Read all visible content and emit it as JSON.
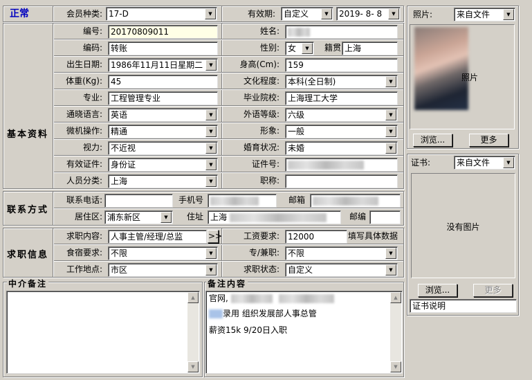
{
  "status": {
    "label": "正常",
    "color": "#0000c0"
  },
  "header": {
    "member_type_label": "会员种类:",
    "member_type_value": "17-D",
    "validity_label": "有效期:",
    "validity_mode": "自定义",
    "validity_date": "2019- 8- 8"
  },
  "sections": {
    "basic": "基本资料",
    "contact": "联系方式",
    "job": "求职信息",
    "agency_notes": "中介备注",
    "notes": "备注内容"
  },
  "basic": {
    "id_label": "编号:",
    "id_value": "20170809011",
    "code_label": "编码:",
    "code_value": "转账",
    "birth_label": "出生日期:",
    "birth_value": "1986年11月11日星期二",
    "weight_label": "体重(Kg):",
    "weight_value": "45",
    "major_label": "专业:",
    "major_value": "工程管理专业",
    "language_label": "通晓语言:",
    "language_value": "英语",
    "computer_label": "微机操作:",
    "computer_value": "精通",
    "vision_label": "视力:",
    "vision_value": "不近视",
    "id_doc_label": "有效证件:",
    "id_doc_value": "身份证",
    "category_label": "人员分类:",
    "category_value": "上海",
    "name_label": "姓名:",
    "gender_label": "性别:",
    "gender_value": "女",
    "native_label": "籍贯",
    "native_value": "上海",
    "height_label": "身高(Cm):",
    "height_value": "159",
    "education_label": "文化程度:",
    "education_value": "本科(全日制)",
    "school_label": "毕业院校:",
    "school_value": "上海理工大学",
    "foreign_level_label": "外语等级:",
    "foreign_level_value": "六级",
    "appearance_label": "形象:",
    "appearance_value": "一般",
    "marital_label": "婚育状况:",
    "marital_value": "未婚",
    "cert_no_label": "证件号:",
    "title_label": "职称:"
  },
  "contact": {
    "phone_label": "联系电话:",
    "mobile_label": "手机号",
    "email_label": "邮箱",
    "district_label": "居住区:",
    "district_value": "浦东新区",
    "address_label": "住址",
    "address_value": "上海",
    "postcode_label": "邮编"
  },
  "job": {
    "content_label": "求职内容:",
    "content_value": "人事主管/经理/总监",
    "more_btn": ">>",
    "salary_label": "工资要求:",
    "salary_value": "12000",
    "salary_hint": "填写具体数据",
    "board_label": "食宿要求:",
    "board_value": "不限",
    "fulltime_label": "专/兼职:",
    "fulltime_value": "不限",
    "location_label": "工作地点:",
    "location_value": "市区",
    "status_label": "求职状态:",
    "status_value": "自定义"
  },
  "notes": {
    "line1_prefix": "官网,",
    "line2_suffix": "录用  组织发展部人事总管",
    "line3": "薪资15k 9/20日入职"
  },
  "photo": {
    "label": "照片:",
    "source": "来自文件",
    "overlay_text": "照片",
    "browse_btn": "浏览...",
    "more_btn": "更多"
  },
  "certificate": {
    "label": "证书:",
    "source": "来自文件",
    "empty_text": "没有图片",
    "browse_btn": "浏览...",
    "more_btn": "更多",
    "desc_label": "证书说明"
  }
}
